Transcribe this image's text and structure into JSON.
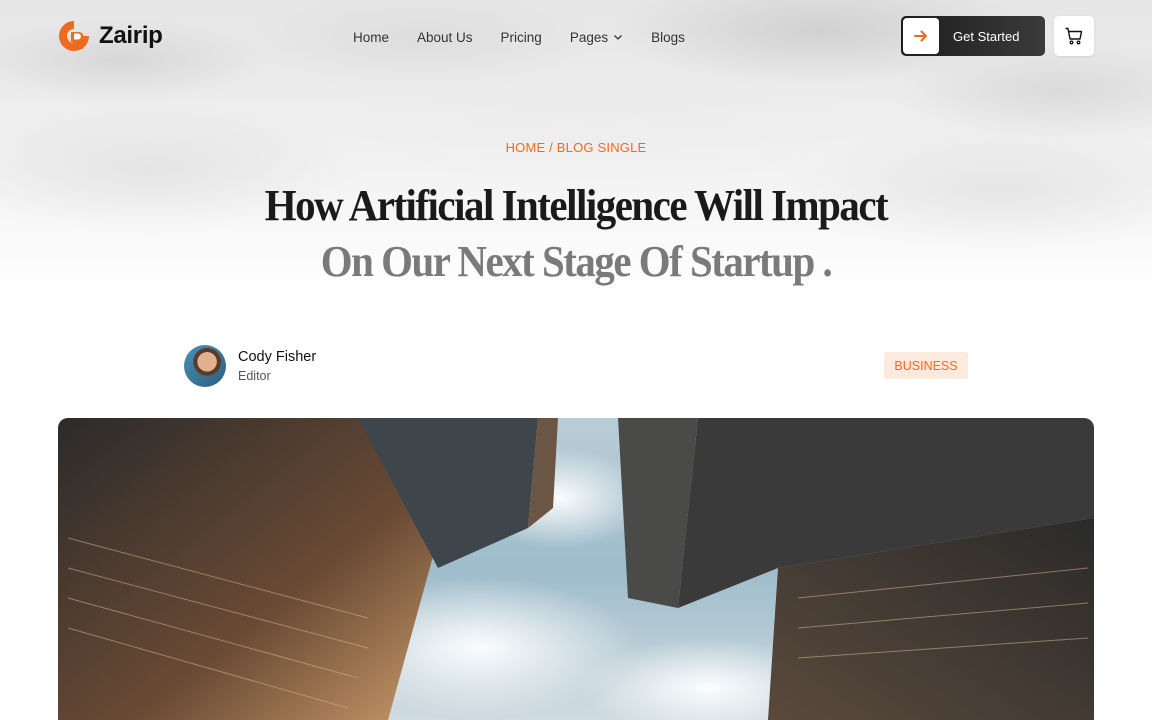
{
  "brand": {
    "name": "Zairip",
    "accent": "#EE6A1F"
  },
  "nav": {
    "items": [
      {
        "label": "Home"
      },
      {
        "label": "About Us"
      },
      {
        "label": "Pricing"
      },
      {
        "label": "Pages",
        "icon": "chevron-down-icon"
      },
      {
        "label": "Blogs"
      }
    ]
  },
  "cta": {
    "label": "Get Started",
    "icon": "arrow-right-icon"
  },
  "cart": {
    "icon": "cart-icon"
  },
  "breadcrumb": "HOME / BLOG SINGLE",
  "title": {
    "line1": "How Artificial Intelligence Will Impact",
    "line2": "On Our Next Stage Of Startup ."
  },
  "author": {
    "name": "Cody Fisher",
    "role": "Editor"
  },
  "category": "BUSINESS",
  "featured_image": {
    "subject": "skyscrapers viewed from below against cloudy sky"
  }
}
